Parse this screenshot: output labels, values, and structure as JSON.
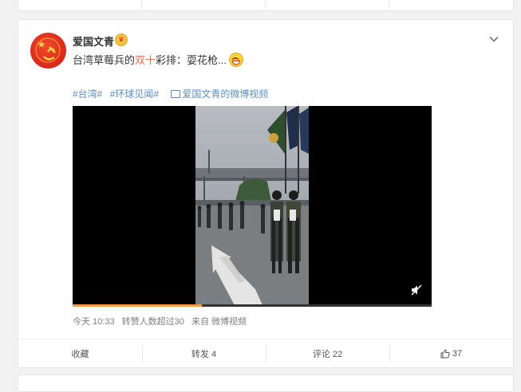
{
  "post": {
    "username": "爱国文青",
    "text_before": "台湾草莓兵的",
    "text_highlight": "双十",
    "text_after": "彩排：耍花枪...",
    "tags": [
      "#台湾#",
      "#环球见闻#"
    ],
    "video_link": "爱国文青的微博视频",
    "video_progress": 0.36,
    "meta": {
      "time": "今天 10:33",
      "views": "转赞人数超过30",
      "source": "来自 微博视频"
    },
    "actions": {
      "favorite": "收藏",
      "repost": "转发 4",
      "comment": "评论 22",
      "like": "37"
    }
  },
  "colors": {
    "link": "#5d8fc4",
    "highlight": "#eb7350",
    "progress": "#f09e4a"
  },
  "icons": [
    "crown-badge-icon",
    "chevron-down-icon",
    "video-link-icon",
    "mute-icon",
    "thumbs-up-icon"
  ]
}
